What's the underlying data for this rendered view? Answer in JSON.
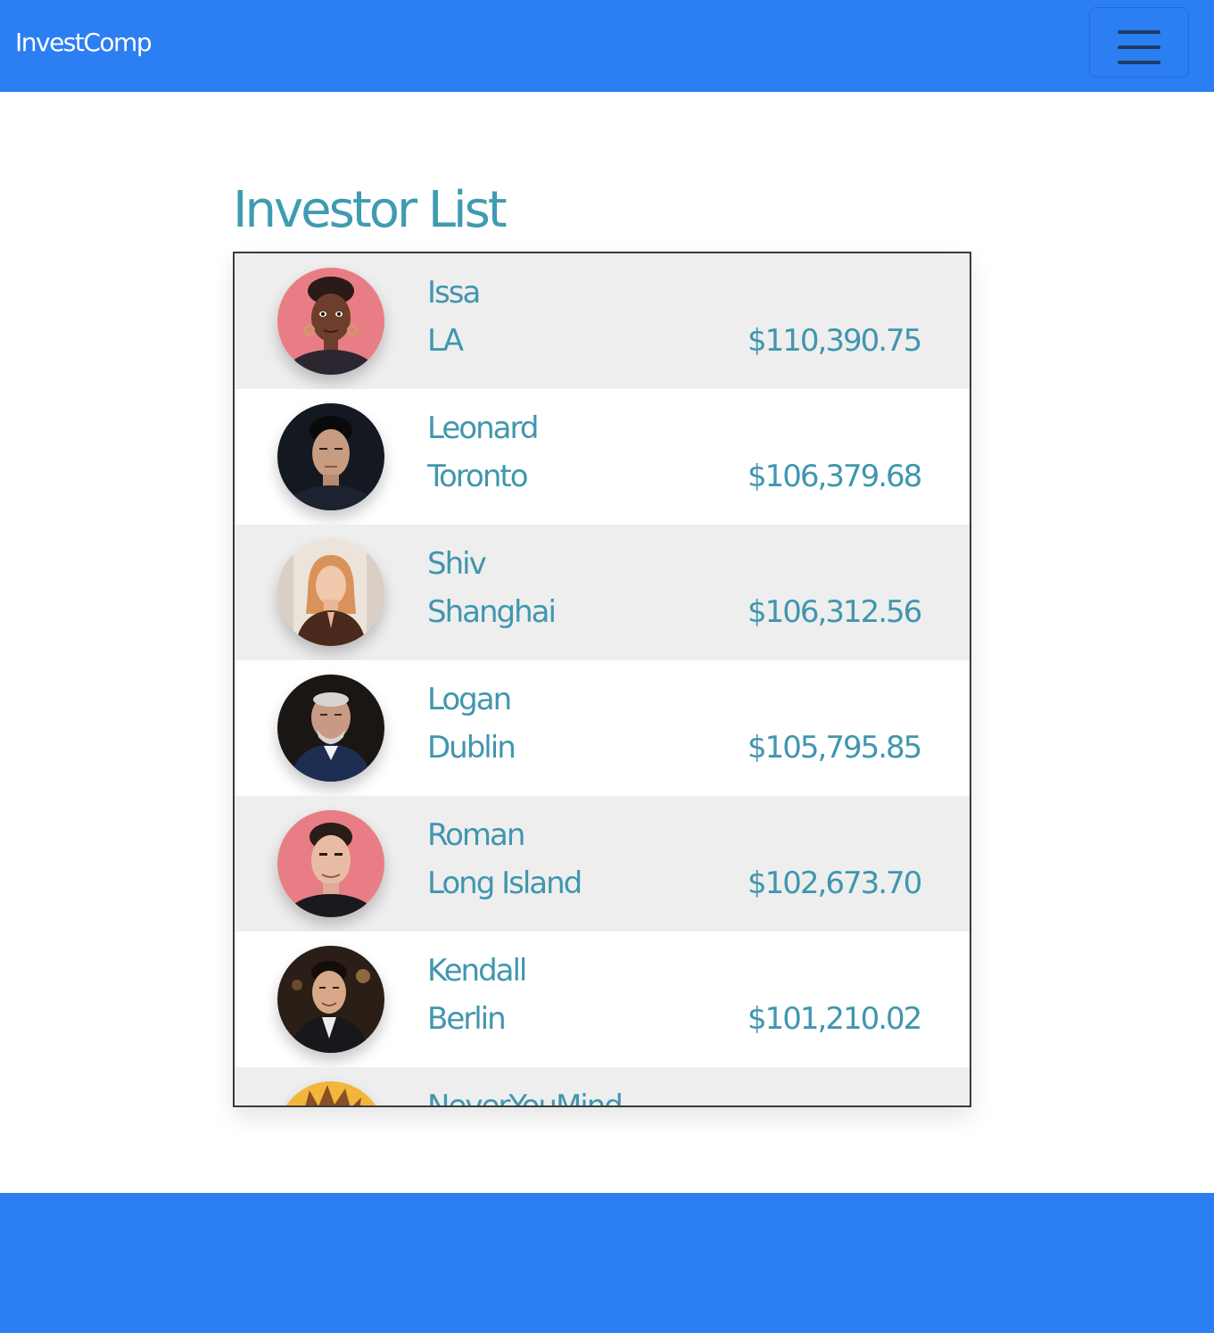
{
  "navbar": {
    "brand": "InvestComp",
    "toggler_icon": "hamburger-menu-icon",
    "background_color": "#2c7ef3"
  },
  "main": {
    "title": "Investor List",
    "accent_color": "#3f9bb0",
    "investors": [
      {
        "name": "Issa",
        "city": "LA",
        "amount": "$110,390.75",
        "avatar_icon": "avatar-photo-icon"
      },
      {
        "name": "Leonard",
        "city": "Toronto",
        "amount": "$106,379.68",
        "avatar_icon": "avatar-photo-icon"
      },
      {
        "name": "Shiv",
        "city": "Shanghai",
        "amount": "$106,312.56",
        "avatar_icon": "avatar-photo-icon"
      },
      {
        "name": "Logan",
        "city": "Dublin",
        "amount": "$105,795.85",
        "avatar_icon": "avatar-photo-icon"
      },
      {
        "name": "Roman",
        "city": "Long Island",
        "amount": "$102,673.70",
        "avatar_icon": "avatar-photo-icon"
      },
      {
        "name": "Kendall",
        "city": "Berlin",
        "amount": "$101,210.02",
        "avatar_icon": "avatar-photo-icon"
      },
      {
        "name": "NeverYouMind",
        "city": "",
        "amount": "",
        "avatar_icon": "avatar-cartoon-icon"
      }
    ]
  },
  "footer": {
    "background_color": "#2c7ef3"
  }
}
